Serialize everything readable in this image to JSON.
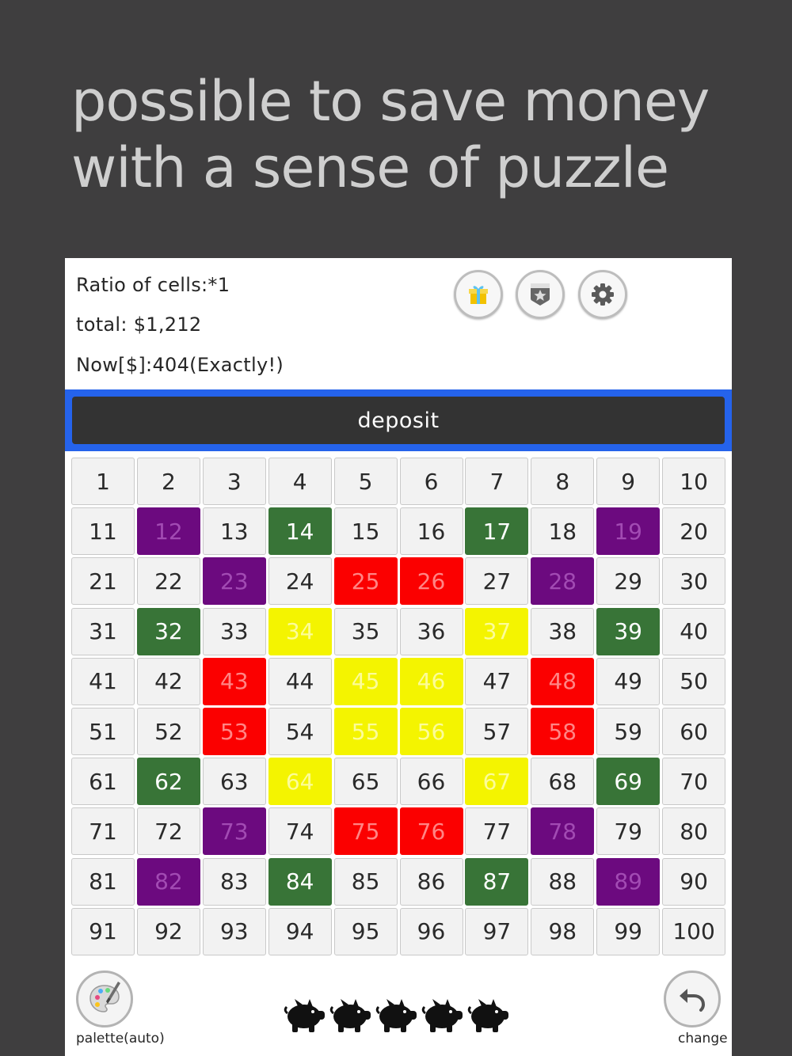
{
  "headline": {
    "line1": "possible to save money",
    "line2": "with a sense of puzzle"
  },
  "info": {
    "ratio": "Ratio of cells:*1",
    "total": "total: $1,212",
    "now": "Now[$]:404(Exactly!)"
  },
  "toolbar": {
    "icons": [
      "gift-icon",
      "badge-icon",
      "gear-icon"
    ]
  },
  "deposit": {
    "label": "deposit"
  },
  "colors": {
    "default": "#f2f2f2",
    "purple": "#6c0a7f",
    "green": "#387437",
    "red": "#fb0000",
    "yellow": "#f4f400"
  },
  "grid": {
    "rows": 10,
    "cols": 10,
    "cells": [
      1,
      2,
      3,
      4,
      5,
      6,
      7,
      8,
      9,
      10,
      11,
      12,
      13,
      14,
      15,
      16,
      17,
      18,
      19,
      20,
      21,
      22,
      23,
      24,
      25,
      26,
      27,
      28,
      29,
      30,
      31,
      32,
      33,
      34,
      35,
      36,
      37,
      38,
      39,
      40,
      41,
      42,
      43,
      44,
      45,
      46,
      47,
      48,
      49,
      50,
      51,
      52,
      53,
      54,
      55,
      56,
      57,
      58,
      59,
      60,
      61,
      62,
      63,
      64,
      65,
      66,
      67,
      68,
      69,
      70,
      71,
      72,
      73,
      74,
      75,
      76,
      77,
      78,
      79,
      80,
      81,
      82,
      83,
      84,
      85,
      86,
      87,
      88,
      89,
      90,
      91,
      92,
      93,
      94,
      95,
      96,
      97,
      98,
      99,
      100
    ],
    "colored": {
      "purple": [
        12,
        19,
        23,
        28,
        73,
        78,
        82,
        89
      ],
      "green": [
        14,
        17,
        32,
        39,
        62,
        69,
        84,
        87
      ],
      "red": [
        25,
        26,
        43,
        48,
        53,
        58,
        75,
        76
      ],
      "yellow": [
        34,
        37,
        45,
        46,
        55,
        56,
        64,
        67
      ]
    }
  },
  "bottom": {
    "palette_label": "palette(auto)",
    "change_label": "change",
    "pig_count": 5
  }
}
